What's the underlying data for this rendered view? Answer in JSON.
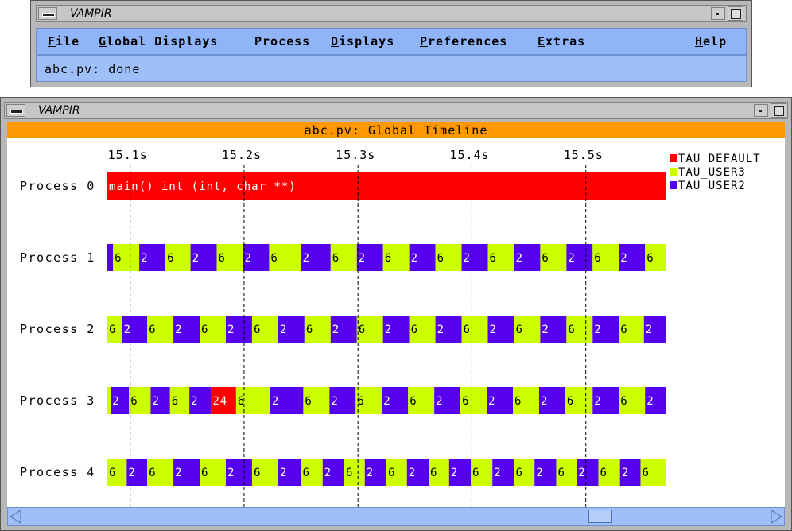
{
  "top_window": {
    "title": "VAMPIR",
    "menu": [
      {
        "mnemonic": "F",
        "rest": "ile"
      },
      {
        "mnemonic": "G",
        "rest": "lobal Displays"
      },
      {
        "mnemonic": "",
        "rest": "Process"
      },
      {
        "mnemonic": "D",
        "rest": "isplays"
      },
      {
        "mnemonic": "P",
        "rest": "references"
      },
      {
        "mnemonic": "E",
        "rest": "xtras"
      },
      {
        "mnemonic": "H",
        "rest": "elp"
      }
    ],
    "status": "abc.pv: done"
  },
  "main_window": {
    "title": "VAMPIR",
    "header": "abc.pv: Global Timeline"
  },
  "colors": {
    "TAU_DEFAULT": "#ff0000",
    "TAU_USER3": "#ccff00",
    "TAU_USER2": "#5500ee",
    "menubar": "#8fb4f7",
    "header": "#ff9800"
  },
  "chart_data": {
    "type": "timeline",
    "time_axis": {
      "start": 15.08,
      "end": 15.57,
      "ticks": [
        15.1,
        15.2,
        15.3,
        15.4,
        15.5
      ],
      "tick_labels": [
        "15.1s",
        "15.2s",
        "15.3s",
        "15.4s",
        "15.5s"
      ],
      "unit": "s"
    },
    "legend": [
      {
        "name": "TAU_DEFAULT",
        "color": "#ff0000"
      },
      {
        "name": "TAU_USER3",
        "color": "#ccff00"
      },
      {
        "name": "TAU_USER2",
        "color": "#5500ee"
      }
    ],
    "processes": [
      {
        "label": "Process 0",
        "segments": [
          {
            "start": 15.08,
            "end": 15.57,
            "state": "TAU_DEFAULT",
            "text": "main() int (int, char **)"
          }
        ]
      },
      {
        "label": "Process 1",
        "segments": [
          {
            "start": 15.08,
            "end": 15.085,
            "state": "TAU_USER2",
            "text": ""
          },
          {
            "start": 15.085,
            "end": 15.108,
            "state": "TAU_USER3",
            "text": "6"
          },
          {
            "start": 15.108,
            "end": 15.131,
            "state": "TAU_USER2",
            "text": "2"
          },
          {
            "start": 15.131,
            "end": 15.153,
            "state": "TAU_USER3",
            "text": "6"
          },
          {
            "start": 15.153,
            "end": 15.176,
            "state": "TAU_USER2",
            "text": "2"
          },
          {
            "start": 15.176,
            "end": 15.199,
            "state": "TAU_USER3",
            "text": "6"
          },
          {
            "start": 15.199,
            "end": 15.222,
            "state": "TAU_USER2",
            "text": "2"
          },
          {
            "start": 15.222,
            "end": 15.25,
            "state": "TAU_USER3",
            "text": "6"
          },
          {
            "start": 15.25,
            "end": 15.276,
            "state": "TAU_USER2",
            "text": "2"
          },
          {
            "start": 15.276,
            "end": 15.299,
            "state": "TAU_USER3",
            "text": "6"
          },
          {
            "start": 15.299,
            "end": 15.322,
            "state": "TAU_USER2",
            "text": "2"
          },
          {
            "start": 15.322,
            "end": 15.345,
            "state": "TAU_USER3",
            "text": "6"
          },
          {
            "start": 15.345,
            "end": 15.368,
            "state": "TAU_USER2",
            "text": "2"
          },
          {
            "start": 15.368,
            "end": 15.391,
            "state": "TAU_USER3",
            "text": "6"
          },
          {
            "start": 15.391,
            "end": 15.414,
            "state": "TAU_USER2",
            "text": "2"
          },
          {
            "start": 15.414,
            "end": 15.437,
            "state": "TAU_USER3",
            "text": "6"
          },
          {
            "start": 15.437,
            "end": 15.46,
            "state": "TAU_USER2",
            "text": "2"
          },
          {
            "start": 15.46,
            "end": 15.483,
            "state": "TAU_USER3",
            "text": "6"
          },
          {
            "start": 15.483,
            "end": 15.506,
            "state": "TAU_USER2",
            "text": "2"
          },
          {
            "start": 15.506,
            "end": 15.529,
            "state": "TAU_USER3",
            "text": "6"
          },
          {
            "start": 15.529,
            "end": 15.552,
            "state": "TAU_USER2",
            "text": "2"
          },
          {
            "start": 15.552,
            "end": 15.57,
            "state": "TAU_USER3",
            "text": "6"
          }
        ]
      },
      {
        "label": "Process 2",
        "segments": [
          {
            "start": 15.08,
            "end": 15.093,
            "state": "TAU_USER3",
            "text": "6"
          },
          {
            "start": 15.093,
            "end": 15.115,
            "state": "TAU_USER2",
            "text": "2"
          },
          {
            "start": 15.115,
            "end": 15.138,
            "state": "TAU_USER3",
            "text": "6"
          },
          {
            "start": 15.138,
            "end": 15.161,
            "state": "TAU_USER2",
            "text": "2"
          },
          {
            "start": 15.161,
            "end": 15.184,
            "state": "TAU_USER3",
            "text": "6"
          },
          {
            "start": 15.184,
            "end": 15.207,
            "state": "TAU_USER2",
            "text": "2"
          },
          {
            "start": 15.207,
            "end": 15.23,
            "state": "TAU_USER3",
            "text": "6"
          },
          {
            "start": 15.23,
            "end": 15.253,
            "state": "TAU_USER2",
            "text": "2"
          },
          {
            "start": 15.253,
            "end": 15.276,
            "state": "TAU_USER3",
            "text": "6"
          },
          {
            "start": 15.276,
            "end": 15.299,
            "state": "TAU_USER2",
            "text": "2"
          },
          {
            "start": 15.299,
            "end": 15.322,
            "state": "TAU_USER3",
            "text": "6"
          },
          {
            "start": 15.322,
            "end": 15.345,
            "state": "TAU_USER2",
            "text": "2"
          },
          {
            "start": 15.345,
            "end": 15.368,
            "state": "TAU_USER3",
            "text": "6"
          },
          {
            "start": 15.368,
            "end": 15.391,
            "state": "TAU_USER2",
            "text": "2"
          },
          {
            "start": 15.391,
            "end": 15.414,
            "state": "TAU_USER3",
            "text": "6"
          },
          {
            "start": 15.414,
            "end": 15.437,
            "state": "TAU_USER2",
            "text": "2"
          },
          {
            "start": 15.437,
            "end": 15.46,
            "state": "TAU_USER3",
            "text": "6"
          },
          {
            "start": 15.46,
            "end": 15.483,
            "state": "TAU_USER2",
            "text": "2"
          },
          {
            "start": 15.483,
            "end": 15.506,
            "state": "TAU_USER3",
            "text": "6"
          },
          {
            "start": 15.506,
            "end": 15.529,
            "state": "TAU_USER2",
            "text": "2"
          },
          {
            "start": 15.529,
            "end": 15.551,
            "state": "TAU_USER3",
            "text": "6"
          },
          {
            "start": 15.551,
            "end": 15.57,
            "state": "TAU_USER2",
            "text": "2"
          }
        ]
      },
      {
        "label": "Process 3",
        "segments": [
          {
            "start": 15.08,
            "end": 15.083,
            "state": "TAU_USER3",
            "text": ""
          },
          {
            "start": 15.083,
            "end": 15.099,
            "state": "TAU_USER2",
            "text": "2"
          },
          {
            "start": 15.099,
            "end": 15.118,
            "state": "TAU_USER3",
            "text": "6"
          },
          {
            "start": 15.118,
            "end": 15.135,
            "state": "TAU_USER2",
            "text": "2"
          },
          {
            "start": 15.135,
            "end": 15.152,
            "state": "TAU_USER3",
            "text": "6"
          },
          {
            "start": 15.152,
            "end": 15.171,
            "state": "TAU_USER2",
            "text": "2"
          },
          {
            "start": 15.171,
            "end": 15.193,
            "state": "TAU_DEFAULT",
            "text": "24"
          },
          {
            "start": 15.193,
            "end": 15.223,
            "state": "TAU_USER3",
            "text": "6"
          },
          {
            "start": 15.223,
            "end": 15.252,
            "state": "TAU_USER2",
            "text": "2"
          },
          {
            "start": 15.252,
            "end": 15.275,
            "state": "TAU_USER3",
            "text": "6"
          },
          {
            "start": 15.275,
            "end": 15.298,
            "state": "TAU_USER2",
            "text": "2"
          },
          {
            "start": 15.298,
            "end": 15.321,
            "state": "TAU_USER3",
            "text": "6"
          },
          {
            "start": 15.321,
            "end": 15.344,
            "state": "TAU_USER2",
            "text": "2"
          },
          {
            "start": 15.344,
            "end": 15.367,
            "state": "TAU_USER3",
            "text": "6"
          },
          {
            "start": 15.367,
            "end": 15.39,
            "state": "TAU_USER2",
            "text": "2"
          },
          {
            "start": 15.39,
            "end": 15.413,
            "state": "TAU_USER3",
            "text": "6"
          },
          {
            "start": 15.413,
            "end": 15.436,
            "state": "TAU_USER2",
            "text": "2"
          },
          {
            "start": 15.436,
            "end": 15.459,
            "state": "TAU_USER3",
            "text": "6"
          },
          {
            "start": 15.459,
            "end": 15.482,
            "state": "TAU_USER2",
            "text": "2"
          },
          {
            "start": 15.482,
            "end": 15.506,
            "state": "TAU_USER3",
            "text": "6"
          },
          {
            "start": 15.506,
            "end": 15.529,
            "state": "TAU_USER2",
            "text": "2"
          },
          {
            "start": 15.529,
            "end": 15.552,
            "state": "TAU_USER3",
            "text": "6"
          },
          {
            "start": 15.552,
            "end": 15.57,
            "state": "TAU_USER2",
            "text": "2"
          }
        ]
      },
      {
        "label": "Process 4",
        "segments": [
          {
            "start": 15.08,
            "end": 15.097,
            "state": "TAU_USER3",
            "text": "6"
          },
          {
            "start": 15.097,
            "end": 15.115,
            "state": "TAU_USER2",
            "text": "2"
          },
          {
            "start": 15.115,
            "end": 15.138,
            "state": "TAU_USER3",
            "text": "6"
          },
          {
            "start": 15.138,
            "end": 15.161,
            "state": "TAU_USER2",
            "text": "2"
          },
          {
            "start": 15.161,
            "end": 15.184,
            "state": "TAU_USER3",
            "text": "6"
          },
          {
            "start": 15.184,
            "end": 15.207,
            "state": "TAU_USER2",
            "text": "2"
          },
          {
            "start": 15.207,
            "end": 15.23,
            "state": "TAU_USER3",
            "text": "6"
          },
          {
            "start": 15.23,
            "end": 15.25,
            "state": "TAU_USER2",
            "text": "2"
          },
          {
            "start": 15.25,
            "end": 15.269,
            "state": "TAU_USER3",
            "text": "6"
          },
          {
            "start": 15.269,
            "end": 15.288,
            "state": "TAU_USER2",
            "text": "2"
          },
          {
            "start": 15.288,
            "end": 15.306,
            "state": "TAU_USER3",
            "text": "6"
          },
          {
            "start": 15.306,
            "end": 15.325,
            "state": "TAU_USER2",
            "text": "2"
          },
          {
            "start": 15.325,
            "end": 15.343,
            "state": "TAU_USER3",
            "text": "6"
          },
          {
            "start": 15.343,
            "end": 15.362,
            "state": "TAU_USER2",
            "text": "2"
          },
          {
            "start": 15.362,
            "end": 15.38,
            "state": "TAU_USER3",
            "text": "6"
          },
          {
            "start": 15.38,
            "end": 15.399,
            "state": "TAU_USER2",
            "text": "2"
          },
          {
            "start": 15.399,
            "end": 15.418,
            "state": "TAU_USER3",
            "text": "6"
          },
          {
            "start": 15.418,
            "end": 15.437,
            "state": "TAU_USER2",
            "text": "2"
          },
          {
            "start": 15.437,
            "end": 15.455,
            "state": "TAU_USER3",
            "text": "6"
          },
          {
            "start": 15.455,
            "end": 15.474,
            "state": "TAU_USER2",
            "text": "2"
          },
          {
            "start": 15.474,
            "end": 15.492,
            "state": "TAU_USER3",
            "text": "6"
          },
          {
            "start": 15.492,
            "end": 15.511,
            "state": "TAU_USER2",
            "text": "2"
          },
          {
            "start": 15.511,
            "end": 15.53,
            "state": "TAU_USER3",
            "text": "6"
          },
          {
            "start": 15.53,
            "end": 15.548,
            "state": "TAU_USER2",
            "text": "2"
          },
          {
            "start": 15.548,
            "end": 15.57,
            "state": "TAU_USER3",
            "text": "6"
          }
        ]
      }
    ]
  }
}
